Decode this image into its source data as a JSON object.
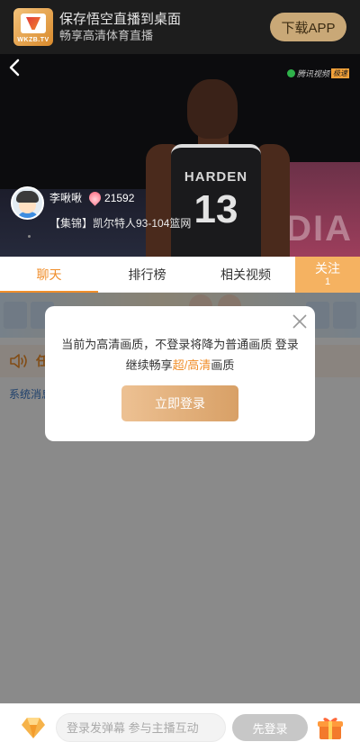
{
  "banner": {
    "logo_text": "WKZB.TV",
    "title": "保存悟空直播到桌面",
    "subtitle": "畅享高清体育直播",
    "download_label": "下载APP"
  },
  "video": {
    "watermark_text": "腾讯视频",
    "watermark_badge": "极速",
    "jersey_name": "HARDEN",
    "jersey_number": "13",
    "ad_text": "DIA"
  },
  "anchor": {
    "name": "李啾啾",
    "heat": "21592",
    "title": "【集锦】凯尔特人93-104篮网"
  },
  "tabs": [
    {
      "label": "聊天",
      "active": true
    },
    {
      "label": "排行榜",
      "active": false
    },
    {
      "label": "相关视频",
      "active": false
    }
  ],
  "follow": {
    "label": "关注",
    "count": "1"
  },
  "chat": {
    "notice_text": "任",
    "system_label": "系统消息"
  },
  "bottom": {
    "input_placeholder": "登录发弹幕 参与主播互动",
    "login_label": "先登录"
  },
  "modal": {
    "message_part1": "当前为高清画质，不登录将降为普通画质 登录继续畅享",
    "message_highlight": "超/高清",
    "message_part2": "画质",
    "button_label": "立即登录"
  },
  "colors": {
    "accent": "#f08e2a",
    "download_button": "#c9a877",
    "follow_bg": "#f5b261"
  }
}
